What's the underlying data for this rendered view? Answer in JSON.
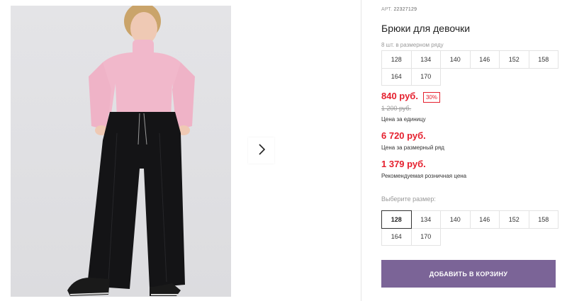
{
  "product": {
    "art_label": "АРТ.",
    "art_number": "22327129",
    "title": "Брюки для девочки",
    "pack_note": "8 шт. в размерном ряду"
  },
  "pack_sizes": [
    "128",
    "134",
    "140",
    "146",
    "152",
    "158",
    "164",
    "170"
  ],
  "pricing": {
    "unit_price": "840 руб.",
    "discount": "30%",
    "old_price": "1 200 руб.",
    "unit_label": "Цена за единицу",
    "pack_price": "6 720 руб.",
    "pack_label": "Цена за размерный ряд",
    "retail_price": "1 379 руб.",
    "retail_label": "Рекомендуемая розничная цена"
  },
  "size_picker": {
    "label": "Выберите размер:",
    "options": [
      "128",
      "134",
      "140",
      "146",
      "152",
      "158",
      "164",
      "170"
    ],
    "selected": "128"
  },
  "cart_button_label": "ДОБАВИТЬ В КОРЗИНУ",
  "colors": {
    "price_red": "#e5202e",
    "button_purple": "#7b6497"
  },
  "icons": {
    "next": "chevron-right-icon"
  }
}
